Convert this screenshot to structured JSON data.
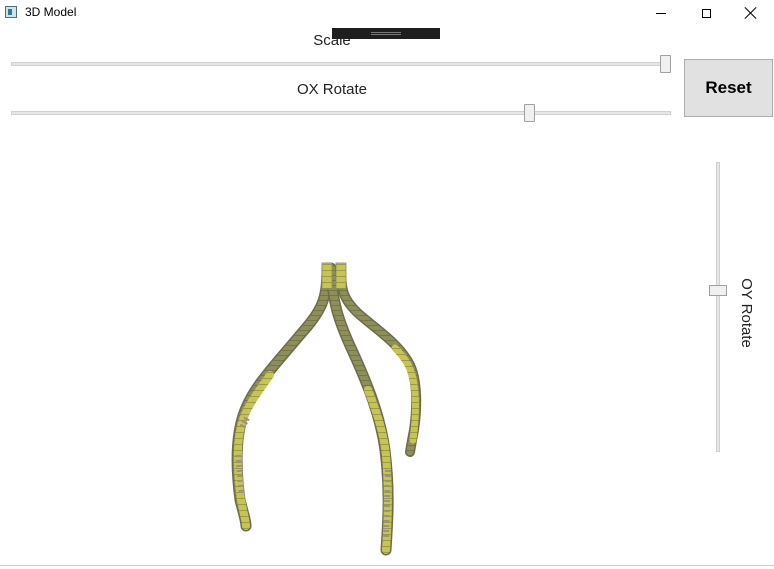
{
  "window": {
    "title": "3D Model",
    "icon": "app-window-icon",
    "controls": [
      "minimize-icon",
      "maximize-icon",
      "close-icon"
    ]
  },
  "scale": {
    "label": "Scale",
    "value": 1.0
  },
  "ox_rotate": {
    "label": "OX Rotate",
    "value": 0.79
  },
  "oy_rotate": {
    "label": "OY Rotate",
    "value": 0.44
  },
  "reset": {
    "label": "Reset"
  },
  "colors": {
    "tube_yellow": "#d2d04a",
    "tube_olive": "#8a8c58",
    "tube_gray": "#9a9088"
  }
}
